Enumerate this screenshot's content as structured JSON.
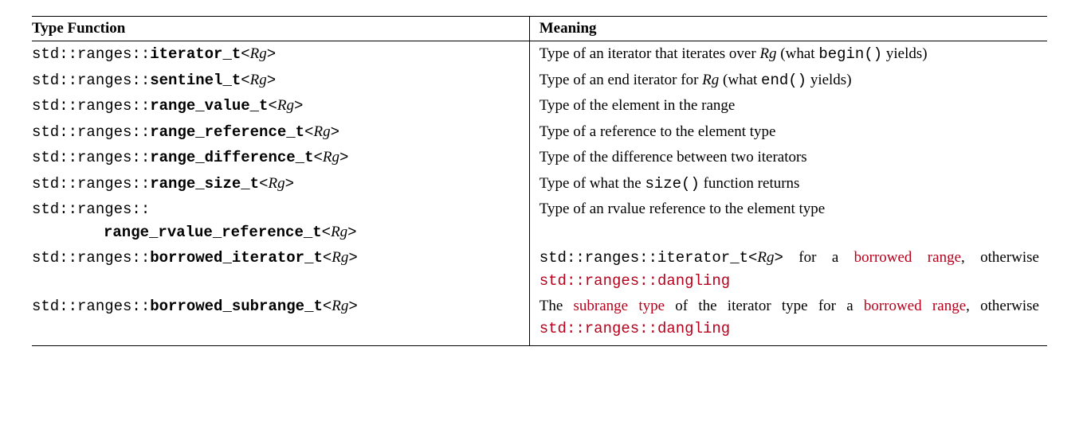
{
  "headers": {
    "col1": "Type Function",
    "col2": "Meaning"
  },
  "ns": "std::ranges::",
  "rg": "Rg",
  "open": "<",
  "close": ">",
  "rows": {
    "r0": {
      "fn": "iterator_t",
      "m_a": "Type of an iterator that iterates over ",
      "m_b": " (what ",
      "m_c": "begin()",
      "m_d": " yields)"
    },
    "r1": {
      "fn": "sentinel_t",
      "m_a": "Type of an end iterator for ",
      "m_b": " (what ",
      "m_c": "end()",
      "m_d": " yields)"
    },
    "r2": {
      "fn": "range_value_t",
      "m": "Type of the element in the range"
    },
    "r3": {
      "fn": "range_reference_t",
      "m": "Type of a reference to the element type"
    },
    "r4": {
      "fn": "range_difference_t",
      "m": "Type of the difference between two iterators"
    },
    "r5": {
      "fn": "range_size_t",
      "m_a": "Type of what the ",
      "m_b": "size()",
      "m_c": " function returns"
    },
    "r6": {
      "wrap": "range_rvalue_reference_t",
      "m": "Type of an rvalue reference to the element type"
    },
    "r7": {
      "fn": "borrowed_iterator_t",
      "m_a": "std::ranges::iterator_t<",
      "m_b": ">",
      "m_c": " for a ",
      "m_d": "borrowed range",
      "m_e": ", otherwise ",
      "m_f": "std::ranges::dangling"
    },
    "r8": {
      "fn": "borrowed_subrange_t",
      "m_a": "The ",
      "m_b": "subrange type",
      "m_c": " of the iterator type for a ",
      "m_d": "borrowed range",
      "m_e": ", otherwise ",
      "m_f": "std::ranges::dangling"
    }
  }
}
